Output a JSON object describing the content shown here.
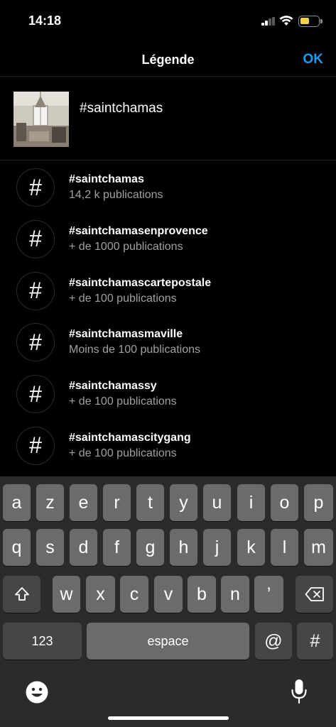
{
  "status_bar": {
    "time": "14:18",
    "battery_color": "#f1d24b"
  },
  "nav": {
    "title": "Légende",
    "ok_label": "OK",
    "accent_color": "#1d9bf0"
  },
  "composer": {
    "caption": "#saintchamas"
  },
  "suggestions": [
    {
      "tag": "#saintchamas",
      "count": "14,2 k publications"
    },
    {
      "tag": "#saintchamasenprovence",
      "count": "+ de 1000 publications"
    },
    {
      "tag": "#saintchamascartepostale",
      "count": "+ de 100 publications"
    },
    {
      "tag": "#saintchamasmaville",
      "count": "Moins de 100 publications"
    },
    {
      "tag": "#saintchamassy",
      "count": "+ de 100 publications"
    },
    {
      "tag": "#saintchamascitygang",
      "count": "+ de 100 publications"
    }
  ],
  "keyboard": {
    "row1": [
      "a",
      "z",
      "e",
      "r",
      "t",
      "y",
      "u",
      "i",
      "o",
      "p"
    ],
    "row2": [
      "q",
      "s",
      "d",
      "f",
      "g",
      "h",
      "j",
      "k",
      "l",
      "m"
    ],
    "row3": [
      "w",
      "x",
      "c",
      "v",
      "b",
      "n",
      "’"
    ],
    "numbers": "123",
    "space": "espace",
    "at": "@",
    "hash": "#"
  },
  "icons": {
    "hash_symbol": "#",
    "shift": "shift-icon",
    "delete": "delete-icon",
    "emoji": "emoji-icon",
    "mic": "microphone-icon"
  }
}
